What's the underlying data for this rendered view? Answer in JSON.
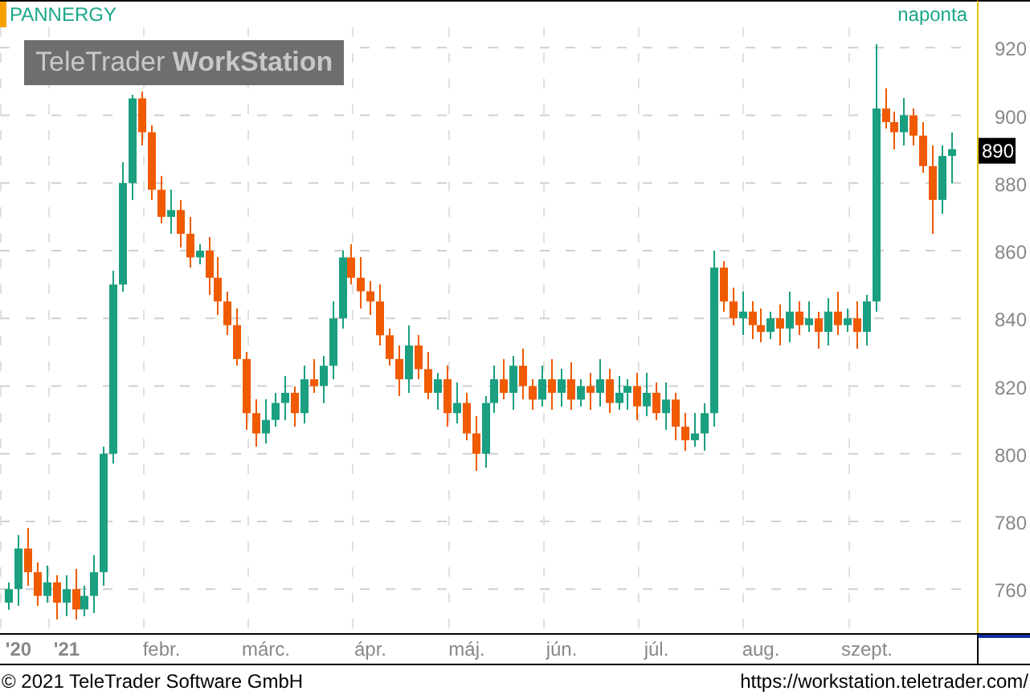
{
  "header": {
    "interval": "naponta"
  },
  "logo": "TeleTrader **WorkStation**",
  "price_badge": "890",
  "chart_data": {
    "type": "candlestick",
    "grid": true,
    "title": "PANNERGY",
    "ylim": [
      747,
      926
    ],
    "yticks": [
      760,
      780,
      800,
      820,
      840,
      860,
      880,
      900,
      920
    ],
    "categories": [
      null,
      "'20",
      null,
      null,
      null,
      null,
      "'21",
      null,
      null,
      null,
      null,
      null,
      null,
      null,
      null,
      null,
      "febr.",
      null,
      null,
      null,
      null,
      null,
      null,
      null,
      null,
      null,
      null,
      "márc.",
      null,
      null,
      null,
      null,
      null,
      null,
      null,
      null,
      null,
      null,
      "ápr.",
      null,
      null,
      null,
      null,
      null,
      null,
      null,
      null,
      null,
      "máj.",
      null,
      null,
      null,
      null,
      null,
      null,
      null,
      null,
      null,
      "jún.",
      null,
      null,
      null,
      null,
      null,
      null,
      null,
      null,
      null,
      "júl.",
      null,
      null,
      null,
      null,
      null,
      null,
      null,
      null,
      null,
      null,
      "aug.",
      null,
      null,
      null,
      null,
      null,
      null,
      null,
      null,
      null,
      null,
      "szept.",
      null,
      null,
      null,
      null,
      null,
      null,
      null,
      null,
      null
    ],
    "ohlc": [
      [
        756,
        762,
        754,
        760
      ],
      [
        760,
        776,
        755,
        772
      ],
      [
        772,
        778,
        761,
        765
      ],
      [
        765,
        768,
        755,
        758
      ],
      [
        758,
        767,
        756,
        762
      ],
      [
        762,
        764,
        751,
        756
      ],
      [
        756,
        764,
        752,
        760
      ],
      [
        760,
        766,
        751,
        754
      ],
      [
        754,
        761,
        752,
        758
      ],
      [
        758,
        770,
        753,
        765
      ],
      [
        765,
        802,
        761,
        800
      ],
      [
        800,
        854,
        797,
        850
      ],
      [
        850,
        886,
        848,
        880
      ],
      [
        880,
        906,
        875,
        905
      ],
      [
        905,
        907,
        891,
        895
      ],
      [
        895,
        897,
        875,
        878
      ],
      [
        878,
        882,
        868,
        870
      ],
      [
        870,
        878,
        865,
        872
      ],
      [
        872,
        875,
        861,
        865
      ],
      [
        865,
        870,
        855,
        858
      ],
      [
        858,
        862,
        856,
        860
      ],
      [
        860,
        864,
        847,
        852
      ],
      [
        852,
        858,
        841,
        845
      ],
      [
        845,
        848,
        835,
        838
      ],
      [
        838,
        843,
        826,
        828
      ],
      [
        828,
        830,
        807,
        812
      ],
      [
        812,
        816,
        802,
        806
      ],
      [
        806,
        816,
        803,
        810
      ],
      [
        810,
        818,
        808,
        815
      ],
      [
        815,
        823,
        810,
        818
      ],
      [
        818,
        820,
        808,
        812
      ],
      [
        812,
        826,
        809,
        822
      ],
      [
        822,
        828,
        818,
        820
      ],
      [
        820,
        829,
        815,
        826
      ],
      [
        826,
        845,
        822,
        840
      ],
      [
        840,
        860,
        837,
        858
      ],
      [
        858,
        862,
        850,
        852
      ],
      [
        852,
        858,
        843,
        848
      ],
      [
        848,
        851,
        841,
        845
      ],
      [
        845,
        850,
        832,
        835
      ],
      [
        835,
        837,
        826,
        828
      ],
      [
        828,
        832,
        817,
        822
      ],
      [
        822,
        838,
        818,
        832
      ],
      [
        832,
        835,
        822,
        825
      ],
      [
        825,
        830,
        816,
        818
      ],
      [
        818,
        824,
        813,
        822
      ],
      [
        822,
        826,
        808,
        812
      ],
      [
        812,
        821,
        809,
        815
      ],
      [
        815,
        818,
        804,
        806
      ],
      [
        806,
        811,
        795,
        800
      ],
      [
        800,
        817,
        796,
        815
      ],
      [
        815,
        826,
        812,
        822
      ],
      [
        822,
        828,
        816,
        818
      ],
      [
        818,
        829,
        813,
        826
      ],
      [
        826,
        831,
        816,
        820
      ],
      [
        820,
        822,
        813,
        816
      ],
      [
        816,
        826,
        814,
        822
      ],
      [
        822,
        828,
        813,
        818
      ],
      [
        818,
        825,
        814,
        822
      ],
      [
        822,
        827,
        813,
        816
      ],
      [
        816,
        822,
        814,
        820
      ],
      [
        820,
        824,
        813,
        818
      ],
      [
        818,
        828,
        814,
        822
      ],
      [
        822,
        825,
        812,
        815
      ],
      [
        815,
        823,
        813,
        818
      ],
      [
        818,
        822,
        813,
        820
      ],
      [
        820,
        824,
        810,
        814
      ],
      [
        814,
        824,
        811,
        818
      ],
      [
        818,
        821,
        810,
        812
      ],
      [
        812,
        821,
        807,
        816
      ],
      [
        816,
        818,
        804,
        808
      ],
      [
        808,
        812,
        801,
        804
      ],
      [
        804,
        812,
        802,
        806
      ],
      [
        806,
        815,
        801,
        812
      ],
      [
        812,
        860,
        808,
        855
      ],
      [
        855,
        857,
        842,
        845
      ],
      [
        845,
        849,
        838,
        840
      ],
      [
        840,
        848,
        835,
        842
      ],
      [
        842,
        845,
        834,
        838
      ],
      [
        838,
        843,
        833,
        836
      ],
      [
        836,
        842,
        834,
        840
      ],
      [
        840,
        844,
        832,
        837
      ],
      [
        837,
        848,
        833,
        842
      ],
      [
        842,
        845,
        835,
        838
      ],
      [
        838,
        845,
        836,
        840
      ],
      [
        840,
        842,
        831,
        836
      ],
      [
        836,
        846,
        832,
        842
      ],
      [
        842,
        848,
        835,
        838
      ],
      [
        838,
        843,
        836,
        840
      ],
      [
        840,
        845,
        831,
        836
      ],
      [
        836,
        847,
        832,
        845
      ],
      [
        845,
        921,
        842,
        902
      ],
      [
        902,
        908,
        896,
        898
      ],
      [
        898,
        901,
        890,
        895
      ],
      [
        895,
        905,
        891,
        900
      ],
      [
        900,
        902,
        891,
        894
      ],
      [
        894,
        898,
        883,
        885
      ],
      [
        885,
        891,
        865,
        875
      ],
      [
        875,
        891,
        871,
        888
      ],
      [
        888,
        895,
        880,
        890
      ]
    ]
  },
  "date_axis": [
    {
      "kind": "year"
    },
    {
      "kind": "year"
    },
    {
      "kind": "month"
    },
    {
      "kind": "month"
    },
    {
      "kind": "month"
    },
    {
      "kind": "month"
    },
    {
      "kind": "month"
    },
    {
      "kind": "month"
    },
    {
      "kind": "month"
    },
    {
      "kind": "month"
    }
  ],
  "footer": {
    "copyright": "© 2021 TeleTrader Software GmbH",
    "url": "https://workstation.teletrader.com/"
  }
}
